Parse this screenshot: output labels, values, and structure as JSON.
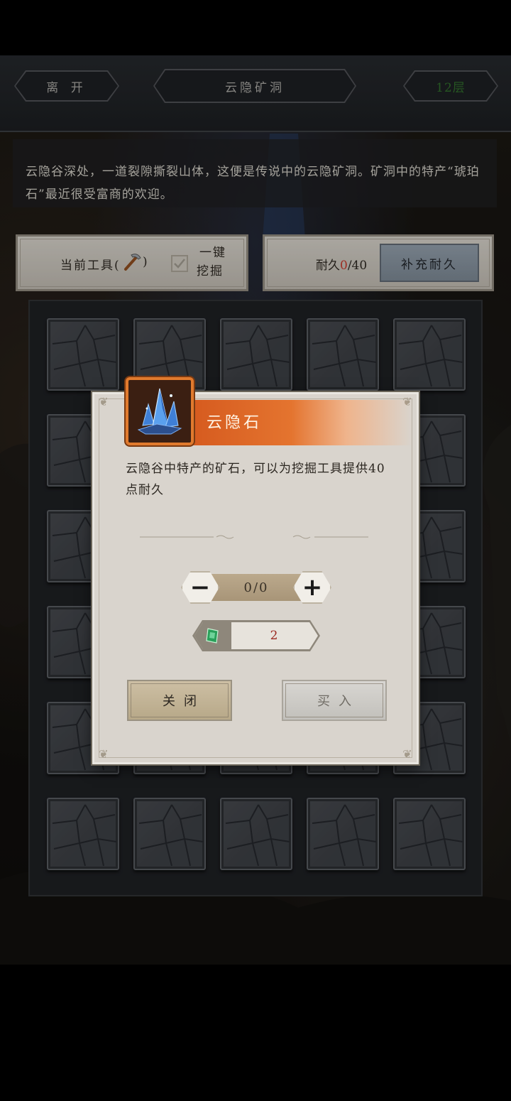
{
  "header": {
    "leave_label": "离 开",
    "location_title": "云隐矿洞",
    "floor_label": "12层"
  },
  "description": "云隐谷深处，一道裂隙撕裂山体，这便是传说中的云隐矿洞。矿洞中的特产“琥珀石”最近很受富商的欢迎。",
  "tool_panel": {
    "current_tool_label": "当前工具(",
    "current_tool_suffix": ")",
    "one_click_line1": "一键",
    "one_click_line2": "挖掘",
    "one_click_checked": true
  },
  "durability_panel": {
    "label": "耐久",
    "current": "0",
    "max": "/40",
    "replenish_button": "补充耐久"
  },
  "grid": {
    "rows": 6,
    "cols": 5
  },
  "modal": {
    "title": "云隐石",
    "description": "云隐谷中特产的矿石，可以为挖掘工具提供40点耐久",
    "quantity": "0/0",
    "minus_label": "−",
    "plus_label": "+",
    "price": "2",
    "close_button": "关闭",
    "buy_button": "买入"
  },
  "colors": {
    "accent_orange": "#e07a2e",
    "durability_red": "#c0392b",
    "floor_green": "#2f6b2a",
    "price_red": "#9c2a22"
  }
}
